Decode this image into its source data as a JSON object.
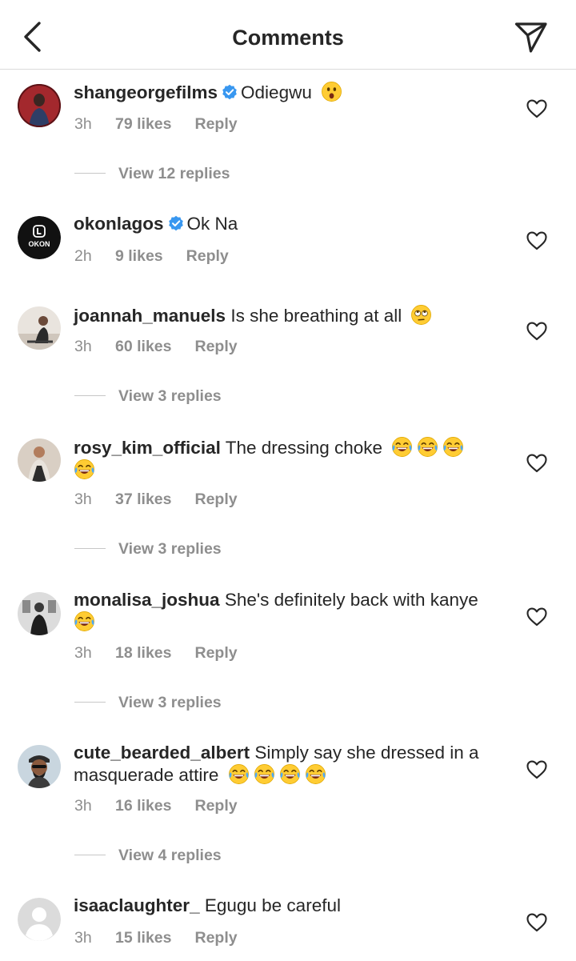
{
  "header": {
    "title": "Comments"
  },
  "icons": {
    "back": "chevron-left-icon",
    "share": "paper-plane-icon",
    "like": "heart-outline-icon",
    "verified": "verified-badge-icon"
  },
  "colors": {
    "verified": "#3897f0",
    "meta": "#8e8e8e",
    "text": "#262626"
  },
  "comments": [
    {
      "username": "shangeorgefilms",
      "verified": true,
      "text": "Odiegwu",
      "emojis": [
        "😮"
      ],
      "time": "3h",
      "likes": "79 likes",
      "reply": "Reply",
      "view_replies": "View 12 replies"
    },
    {
      "username": "okonlagos",
      "verified": true,
      "text": "Ok Na",
      "emojis": [],
      "time": "2h",
      "likes": "9 likes",
      "reply": "Reply",
      "avatar_text": "OKON"
    },
    {
      "username": "joannah_manuels",
      "verified": false,
      "text": "Is she breathing at all",
      "emojis": [
        "🙄"
      ],
      "time": "3h",
      "likes": "60 likes",
      "reply": "Reply",
      "view_replies": "View 3 replies"
    },
    {
      "username": "rosy_kim_official",
      "verified": false,
      "text": "The dressing choke",
      "emojis": [
        "😂",
        "😂",
        "😂",
        "😂"
      ],
      "time": "3h",
      "likes": "37 likes",
      "reply": "Reply",
      "view_replies": "View 3 replies"
    },
    {
      "username": "monalisa_joshua",
      "verified": false,
      "text": "She's definitely back with kanye",
      "emojis": [
        "😂"
      ],
      "time": "3h",
      "likes": "18 likes",
      "reply": "Reply",
      "view_replies": "View 3 replies"
    },
    {
      "username": "cute_bearded_albert",
      "verified": false,
      "text": "Simply say she dressed in a masquerade attire",
      "emojis": [
        "😂",
        "😂",
        "😂",
        "😂"
      ],
      "time": "3h",
      "likes": "16 likes",
      "reply": "Reply",
      "view_replies": "View 4 replies"
    },
    {
      "username": "isaaclaughter_",
      "verified": false,
      "text": "Egugu be careful",
      "emojis": [],
      "time": "3h",
      "likes": "15 likes",
      "reply": "Reply"
    }
  ]
}
